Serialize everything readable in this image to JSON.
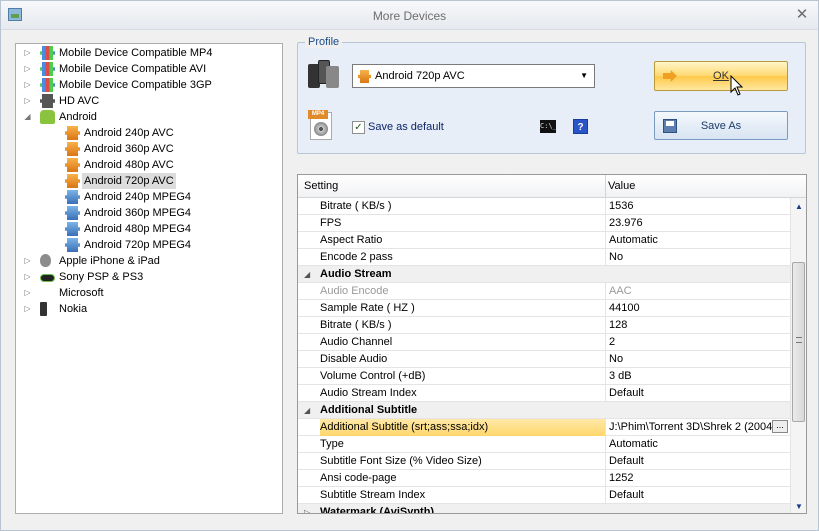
{
  "window": {
    "title": "More Devices",
    "close": "✕"
  },
  "tree": [
    {
      "label": "Mobile Device Compatible MP4",
      "level": 0,
      "expander": "▷",
      "icon": "film-multi-icon",
      "cls": "film multi"
    },
    {
      "label": "Mobile Device Compatible AVI",
      "level": 0,
      "expander": "▷",
      "icon": "film-multi-icon",
      "cls": "film multi"
    },
    {
      "label": "Mobile Device Compatible 3GP",
      "level": 0,
      "expander": "▷",
      "icon": "film-multi-icon",
      "cls": "film multi"
    },
    {
      "label": "HD AVC",
      "level": 0,
      "expander": "▷",
      "icon": "film-icon",
      "cls": "film dark"
    },
    {
      "label": "Android",
      "level": 0,
      "expander": "◢",
      "icon": "android-icon",
      "cls": "android"
    },
    {
      "label": "Android 240p AVC",
      "level": 1,
      "icon": "film-orange-icon",
      "cls": "film orange"
    },
    {
      "label": "Android 360p AVC",
      "level": 1,
      "icon": "film-orange-icon",
      "cls": "film orange"
    },
    {
      "label": "Android 480p AVC",
      "level": 1,
      "icon": "film-orange-icon",
      "cls": "film orange"
    },
    {
      "label": "Android 720p AVC",
      "level": 1,
      "icon": "film-orange-icon",
      "cls": "film orange",
      "selected": true
    },
    {
      "label": "Android 240p MPEG4",
      "level": 1,
      "icon": "film-blue-icon",
      "cls": "film blue"
    },
    {
      "label": "Android 360p MPEG4",
      "level": 1,
      "icon": "film-blue-icon",
      "cls": "film blue"
    },
    {
      "label": "Android 480p MPEG4",
      "level": 1,
      "icon": "film-blue-icon",
      "cls": "film blue"
    },
    {
      "label": "Android 720p MPEG4",
      "level": 1,
      "icon": "film-blue-icon",
      "cls": "film blue"
    },
    {
      "label": "Apple iPhone & iPad",
      "level": 0,
      "expander": "▷",
      "icon": "apple-icon",
      "cls": "apple"
    },
    {
      "label": "Sony PSP & PS3",
      "level": 0,
      "expander": "▷",
      "icon": "psp-icon",
      "cls": "psp"
    },
    {
      "label": "Microsoft",
      "level": 0,
      "expander": "▷",
      "icon": "windows-icon",
      "cls": "ms"
    },
    {
      "label": "Nokia",
      "level": 0,
      "expander": "▷",
      "icon": "nokia-phone-icon",
      "cls": "nokia"
    }
  ],
  "profile": {
    "legend": "Profile",
    "selected": "Android 720p AVC",
    "ok_label": "OK",
    "save_default_label": "Save as default",
    "save_default_checked": "✓",
    "cmd_icon": "C:\\_",
    "help_icon": "?",
    "save_as_label": "Save As"
  },
  "grid": {
    "headers": {
      "setting": "Setting",
      "value": "Value"
    },
    "rows": [
      {
        "k": "Bitrate ( KB/s )",
        "v": "1536"
      },
      {
        "k": "FPS",
        "v": "23.976"
      },
      {
        "k": "Aspect Ratio",
        "v": "Automatic"
      },
      {
        "k": "Encode 2 pass",
        "v": "No"
      },
      {
        "k": "Audio Stream",
        "cat": true,
        "tri": "◢"
      },
      {
        "k": "Audio Encode",
        "v": "AAC",
        "dis": true
      },
      {
        "k": "Sample Rate ( HZ )",
        "v": "44100"
      },
      {
        "k": "Bitrate ( KB/s )",
        "v": "128"
      },
      {
        "k": "Audio Channel",
        "v": "2"
      },
      {
        "k": "Disable Audio",
        "v": "No"
      },
      {
        "k": "Volume Control (+dB)",
        "v": "3 dB"
      },
      {
        "k": "Audio Stream Index",
        "v": "Default"
      },
      {
        "k": "Additional Subtitle",
        "cat": true,
        "tri": "◢"
      },
      {
        "k": "Additional Subtitle (srt;ass;ssa;idx)",
        "v": "J:\\Phim\\Torrent 3D\\Shrek 2 (2004",
        "hl": true,
        "ell": "..."
      },
      {
        "k": "Type",
        "v": "Automatic"
      },
      {
        "k": "Subtitle Font Size (% Video Size)",
        "v": "Default"
      },
      {
        "k": "Ansi code-page",
        "v": "1252"
      },
      {
        "k": "Subtitle Stream Index",
        "v": "Default"
      },
      {
        "k": "Watermark (AviSynth)",
        "cat": true,
        "tri": "▷"
      }
    ],
    "scroll_up": "▲",
    "scroll_down": "▼"
  }
}
